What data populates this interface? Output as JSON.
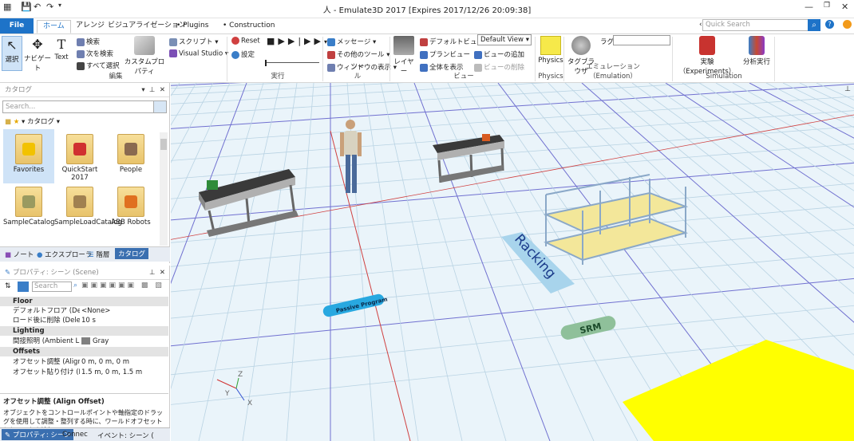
{
  "titlebar": {
    "title": "人 - Emulate3D 2017 [Expires 2017/12/26 20:09:38]"
  },
  "tabs": {
    "file": "File",
    "home": "ホーム",
    "arrange": "アレンジ",
    "visualization": "ビジュアライゼーション",
    "plugins": "• Plugins",
    "construction": "• Construction"
  },
  "quick_search": {
    "placeholder": "Quick Search"
  },
  "ribbon": {
    "select": "選択",
    "navigate": "ナビゲート",
    "text": "Text",
    "search": "検索",
    "search_next": "次を検索",
    "select_all": "すべて選択",
    "custom_props": "カスタムプロパティ",
    "script": "スクリプト",
    "visual_studio": "Visual Studio",
    "reset": "Reset",
    "settings": "設定",
    "message": "メッセージ",
    "other_tools": "その他のツール",
    "window_display": "ウィンドウの表示",
    "layer": "レイヤー",
    "default_view": "デフォルトビュー",
    "plan_view": "プランビュー",
    "show_all": "全体を表示",
    "view_select": "Default View",
    "add_view": "ビューの追加",
    "delete_view": "ビューの削除",
    "physics": "Physics",
    "tag_browser": "タグブラウザ",
    "tag_label": "ラグ",
    "experiments": "実験（Experiments）",
    "analysis": "分析実行",
    "group_edit": "編集",
    "group_run": "実行",
    "group_tools": "ツール",
    "group_view": "ビュー",
    "group_physics": "Physics",
    "group_emulation": "エミュレーション（Emulation）",
    "group_simulation": "Simulation"
  },
  "catalog": {
    "title": "カタログ",
    "search_placeholder": "Search...",
    "breadcrumb": "カタログ",
    "folders": [
      {
        "label": "Favorites"
      },
      {
        "label": "QuickStart 2017"
      },
      {
        "label": "People"
      },
      {
        "label": "SampleCatalog"
      },
      {
        "label": "SampleLoadCatalog"
      },
      {
        "label": "ABB Robots"
      }
    ]
  },
  "pane_tabs": {
    "note": "ノート",
    "explorer": "エクスプローラ",
    "hierarchy": "階層",
    "catalog": "カタログ"
  },
  "properties": {
    "title": "プロパティ: シーン (Scene)",
    "search_placeholder": "Search",
    "categories": {
      "floor": "Floor",
      "lighting": "Lighting",
      "offsets": "Offsets"
    },
    "rows": {
      "default_floor_k": "デフォルトフロア (Default",
      "default_floor_v": "<None>",
      "delete_after_k": "ロード後に削除 (Delete",
      "delete_after_v": "10 s",
      "ambient_k": "間接照明 (Ambient Lig",
      "ambient_v": "Gray",
      "align_k": "オフセット調整 (Align O",
      "align_v": "0 m, 0 m, 0 m",
      "paste_k": "オフセット貼り付け (Paste",
      "paste_v": "1.5 m, 0 m, 1.5 m"
    },
    "help_title": "オフセット調整 (Align Offset)",
    "help_text": "オブジェクトをコントロールポイントや軸指定のドラッグを使用して調整・整列する時に、ワールドオフセットとしてこれを追加..."
  },
  "bottom_tabs": {
    "props": "プロパティ: シーン",
    "connect": "Connec",
    "events": "イベント: シーン ("
  },
  "scene": {
    "racking_label": "Racking",
    "srm_label": "SRM",
    "passive_label": "Passive Program",
    "axes": [
      "X",
      "Y",
      "Z"
    ]
  },
  "colors": {
    "accent": "#1e73c8",
    "floor": "#eaf4fa",
    "yellow": "#ffff00"
  }
}
